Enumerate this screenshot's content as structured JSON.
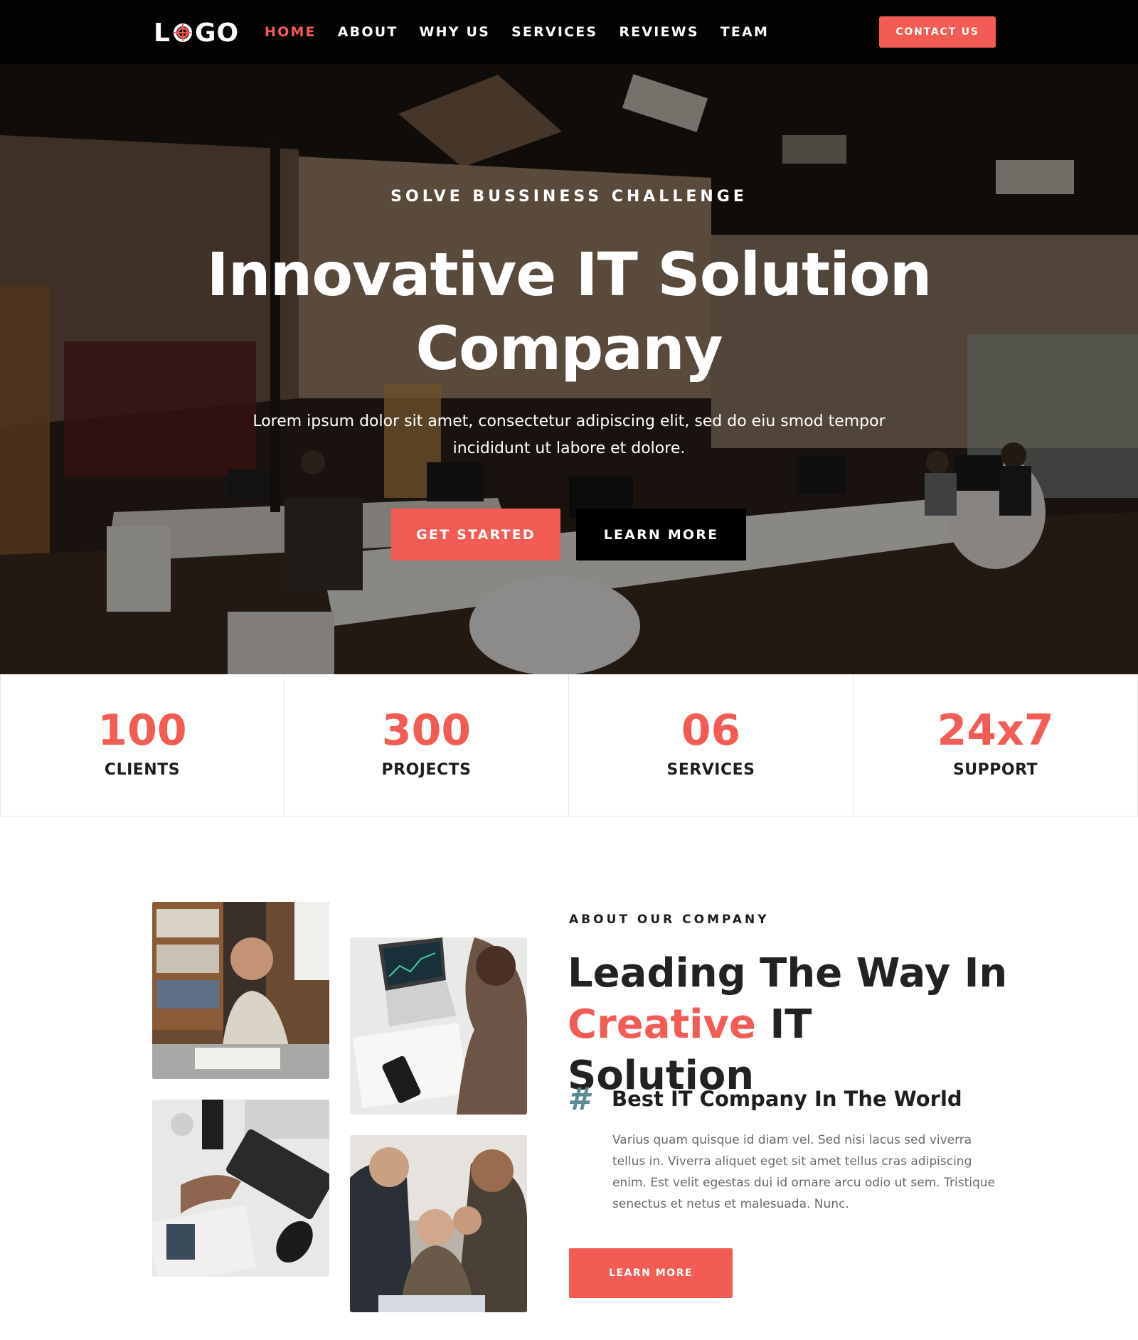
{
  "header": {
    "logo_left": "L",
    "logo_right": "GO",
    "nav": [
      {
        "label": "HOME",
        "active": true
      },
      {
        "label": "ABOUT",
        "active": false
      },
      {
        "label": "WHY US",
        "active": false
      },
      {
        "label": "SERVICES",
        "active": false
      },
      {
        "label": "REVIEWS",
        "active": false
      },
      {
        "label": "TEAM",
        "active": false
      }
    ],
    "contact_label": "CONTACT US"
  },
  "hero": {
    "kicker": "SOLVE BUSSINESS CHALLENGE",
    "title": "Innovative IT Solution Company",
    "text": "Lorem ipsum dolor sit amet, consectetur adipiscing elit, sed do eiu smod tempor incididunt ut labore et dolore.",
    "primary_label": "GET STARTED",
    "secondary_label": "LEARN MORE"
  },
  "stats": [
    {
      "value": "100",
      "label": "CLIENTS"
    },
    {
      "value": "300",
      "label": "PROJECTS"
    },
    {
      "value": "06",
      "label": "SERVICES"
    },
    {
      "value": "24x7",
      "label": "SUPPORT"
    }
  ],
  "about": {
    "kicker": "ABOUT OUR COMPANY",
    "title_line1": "Leading The Way In",
    "title_accent": "Creative",
    "title_rest": "IT Solution",
    "feature_icon": "hash-icon",
    "feature_title": "Best IT Company In The World",
    "feature_text": "Varius quam quisque id diam vel. Sed nisi lacus sed viverra tellus in. Viverra aliquet eget sit amet tellus cras adipiscing enim. Est velit egestas dui id ornare arcu odio ut sem. Tristique senectus et netus et malesuada. Nunc.",
    "button_label": "LEARN MORE"
  },
  "colors": {
    "accent": "#f25c54",
    "dark": "#000000",
    "hash": "#5a8a96"
  }
}
